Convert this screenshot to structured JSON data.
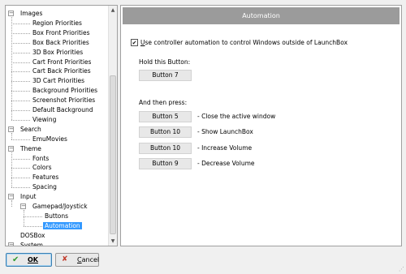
{
  "tree": {
    "items": [
      {
        "label": "Images",
        "depth": 0,
        "expander": "−",
        "selected": false
      },
      {
        "label": "Region Priorities",
        "depth": 1,
        "selected": false
      },
      {
        "label": "Box Front Priorities",
        "depth": 1,
        "selected": false
      },
      {
        "label": "Box Back Priorities",
        "depth": 1,
        "selected": false
      },
      {
        "label": "3D Box Priorities",
        "depth": 1,
        "selected": false
      },
      {
        "label": "Cart Front Priorities",
        "depth": 1,
        "selected": false
      },
      {
        "label": "Cart Back Priorities",
        "depth": 1,
        "selected": false
      },
      {
        "label": "3D Cart Priorities",
        "depth": 1,
        "selected": false
      },
      {
        "label": "Background Priorities",
        "depth": 1,
        "selected": false
      },
      {
        "label": "Screenshot Priorities",
        "depth": 1,
        "selected": false
      },
      {
        "label": "Default Background",
        "depth": 1,
        "selected": false
      },
      {
        "label": "Viewing",
        "depth": 1,
        "selected": false
      },
      {
        "label": "Search",
        "depth": 0,
        "expander": "−",
        "selected": false
      },
      {
        "label": "EmuMovies",
        "depth": 1,
        "selected": false
      },
      {
        "label": "Theme",
        "depth": 0,
        "expander": "−",
        "selected": false
      },
      {
        "label": "Fonts",
        "depth": 1,
        "selected": false
      },
      {
        "label": "Colors",
        "depth": 1,
        "selected": false
      },
      {
        "label": "Features",
        "depth": 1,
        "selected": false
      },
      {
        "label": "Spacing",
        "depth": 1,
        "selected": false
      },
      {
        "label": "Input",
        "depth": 0,
        "expander": "−",
        "selected": false
      },
      {
        "label": "Gamepad/Joystick",
        "depth": 1,
        "expander": "−",
        "selected": false
      },
      {
        "label": "Buttons",
        "depth": 2,
        "selected": false
      },
      {
        "label": "Automation",
        "depth": 2,
        "selected": true
      },
      {
        "label": "DOSBox",
        "depth": 0,
        "selected": false
      },
      {
        "label": "System",
        "depth": 0,
        "expander": "−",
        "selected": false
      }
    ]
  },
  "panel": {
    "title": "Automation",
    "automation_checkbox": {
      "checked": true,
      "check_glyph": "✔",
      "label_underlined": "U",
      "label_rest": "se controller automation to control Windows outside of LaunchBox"
    },
    "hold_label": "Hold this Button:",
    "hold_button": "Button 7",
    "then_label": "And then press:",
    "actions": [
      {
        "button": "Button 5",
        "description": "-  Close the active window"
      },
      {
        "button": "Button 10",
        "description": "-  Show LaunchBox"
      },
      {
        "button": "Button 10",
        "description": "-  Increase Volume"
      },
      {
        "button": "Button 9",
        "description": "-  Decrease Volume"
      }
    ]
  },
  "footer": {
    "ok_label": "OK",
    "ok_icon": "check-icon",
    "cancel_underlined": "C",
    "cancel_rest": "ancel",
    "cancel_icon": "x-icon"
  },
  "colors": {
    "header_bg": "#9b9b9b",
    "selection": "#3399ff",
    "ok_icon": "#2e9a2e",
    "cancel_icon": "#c23b2b"
  }
}
